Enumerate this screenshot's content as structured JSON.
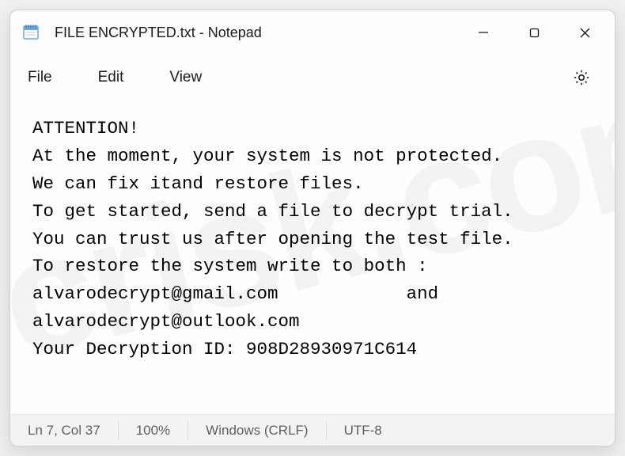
{
  "window": {
    "title": "FILE ENCRYPTED.txt - Notepad"
  },
  "menu": {
    "file": "File",
    "edit": "Edit",
    "view": "View"
  },
  "content": {
    "text": "ATTENTION!\nAt the moment, your system is not protected.\nWe can fix itand restore files.\nTo get started, send a file to decrypt trial.\nYou can trust us after opening the test file.\nTo restore the system write to both :\nalvarodecrypt@gmail.com            and\nalvarodecrypt@outlook.com\nYour Decryption ID: 908D28930971C614"
  },
  "status": {
    "cursor": "Ln 7, Col 37",
    "zoom": "100%",
    "line_ending": "Windows (CRLF)",
    "encoding": "UTF-8"
  },
  "watermark": "pcrisk.com"
}
